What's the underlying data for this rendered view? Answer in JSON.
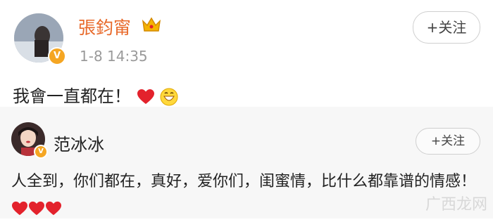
{
  "post": {
    "author": "張鈞甯",
    "time": "1-8  14:35",
    "follow_label": "+关注",
    "text": "我會一直都在！",
    "badge": "V"
  },
  "comment": {
    "author": "范冰冰",
    "follow_label": "+关注",
    "text": "人全到，你们都在，真好，爱你们，闺蜜情，比什么都靠谱的情感！",
    "badge": "V"
  },
  "watermark": "广西龙网",
  "colors": {
    "post_author": "#e8692a",
    "verified_badge": "#f5a623",
    "heart": "#e3222c"
  }
}
